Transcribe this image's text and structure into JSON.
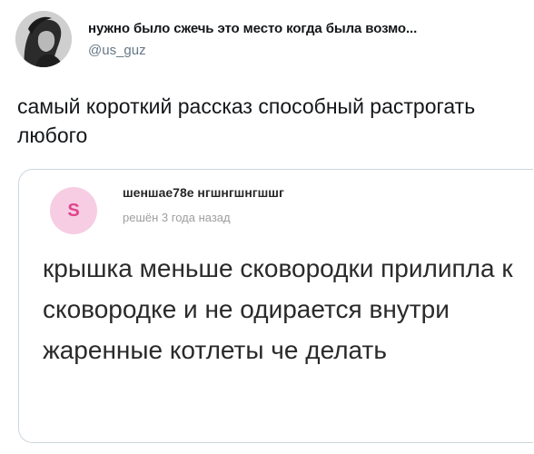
{
  "tweet": {
    "author_name": "нужно было сжечь это место когда была возмо...",
    "author_handle": "@us_guz",
    "text": "самый короткий рассказ способный растрогать любого"
  },
  "quote": {
    "avatar_letter": "S",
    "author_name": "шеншае78е нгшнгшнгшшг",
    "time": "решён 3 года назад",
    "body": "крышка меньше сковородки прилипла к сковородке и не одирается внутри жаренные котлеты че делать"
  },
  "colors": {
    "quote_avatar_bg": "#f6cde3",
    "quote_avatar_letter": "#e0448c",
    "handle_gray": "#657786",
    "border": "#ccd6dd"
  },
  "icons": {
    "tweet_avatar": "profile-photo-avatar"
  }
}
